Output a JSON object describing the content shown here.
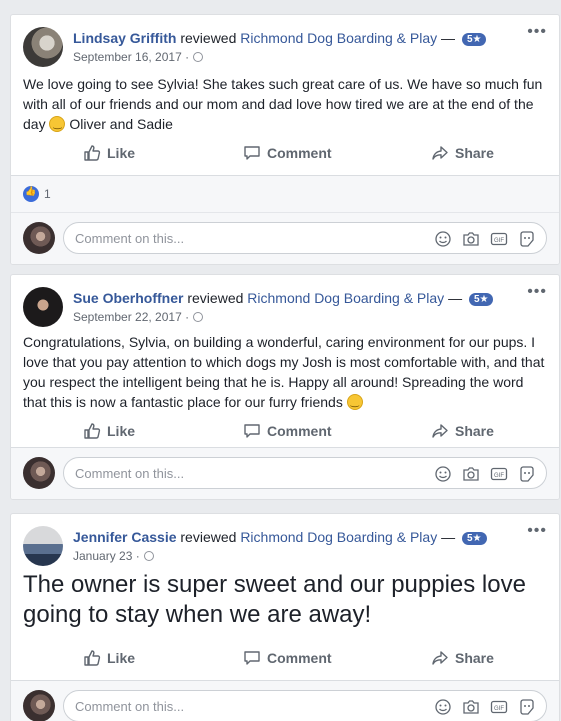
{
  "posts": [
    {
      "author": "Lindsay Griffith",
      "action": "reviewed",
      "page": "Richmond Dog Boarding & Play",
      "separator": "—",
      "badge": "5★",
      "date": "September 16, 2017 ·",
      "text_before": "We love going to see Sylvia! She takes such great care of us. We have so much fun with all of our friends and our mom and dad love how tired we are at the end of the day",
      "text_after": " Oliver and Sadie",
      "like_count": "1"
    },
    {
      "author": "Sue Oberhoffner",
      "action": "reviewed",
      "page": "Richmond Dog Boarding & Play",
      "separator": "—",
      "badge": "5★",
      "date": "September 22, 2017 ·",
      "text_before": "Congratulations, Sylvia, on building a wonderful, caring environment for our pups. I love that you pay attention to which dogs my Josh is most comfortable with, and that you respect the intelligent being that he is. Happy all around! Spreading the word that this is now a fantastic place for our furry friends",
      "text_after": ""
    },
    {
      "author": "Jennifer Cassie",
      "action": "reviewed",
      "page": "Richmond Dog Boarding & Play",
      "separator": "—",
      "badge": "5★",
      "date": "January 23 ·",
      "text": "The owner is super sweet and our puppies love going to stay when we are away!"
    }
  ],
  "actions": {
    "like": "Like",
    "comment": "Comment",
    "share": "Share"
  },
  "comment_placeholder": "Comment on this...",
  "more_label": "•••",
  "gif_label": "GIF",
  "colors": {
    "link": "#365899",
    "badge": "#4267b2",
    "muted": "#606770",
    "background": "#e9ebee"
  },
  "icons": [
    "thumbs-up-icon",
    "comment-bubble-icon",
    "share-arrow-icon",
    "globe-icon",
    "emoji-icon",
    "camera-icon",
    "gif-icon",
    "sticker-icon",
    "more-icon"
  ]
}
